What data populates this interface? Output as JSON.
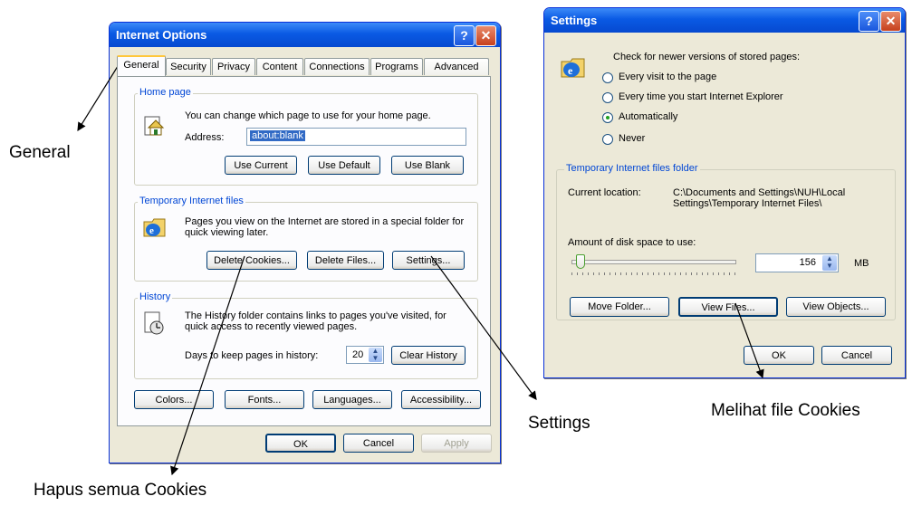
{
  "callouts": {
    "general": "General",
    "delete_cookies": "Hapus semua Cookies",
    "settings": "Settings",
    "view_files": "Melihat file Cookies"
  },
  "internet_options": {
    "title": "Internet Options",
    "help_glyph": "?",
    "close_glyph": "✕",
    "tabs": [
      "General",
      "Security",
      "Privacy",
      "Content",
      "Connections",
      "Programs",
      "Advanced"
    ],
    "home_page": {
      "label": "Home page",
      "description": "You can change which page to use for your home page.",
      "address_label": "Address:",
      "address_value": "about:blank",
      "buttons": [
        "Use Current",
        "Use Default",
        "Use Blank"
      ]
    },
    "temp_files": {
      "label": "Temporary Internet files",
      "description": "Pages you view on the Internet are stored in a special folder for quick viewing later.",
      "buttons": [
        "Delete Cookies...",
        "Delete Files...",
        "Settings..."
      ]
    },
    "history": {
      "label": "History",
      "description": "The History folder contains links to pages you've visited, for quick access to recently viewed pages.",
      "days_label": "Days to keep pages in history:",
      "days_value": "20",
      "clear_button": "Clear History"
    },
    "bottom_buttons": [
      "Colors...",
      "Fonts...",
      "Languages...",
      "Accessibility..."
    ],
    "dialog_buttons": {
      "ok": "OK",
      "cancel": "Cancel",
      "apply": "Apply"
    }
  },
  "settings": {
    "title": "Settings",
    "help_glyph": "?",
    "close_glyph": "✕",
    "check_label": "Check for newer versions of stored pages:",
    "options": [
      "Every visit to the page",
      "Every time you start Internet Explorer",
      "Automatically",
      "Never"
    ],
    "selected_option": "Automatically",
    "folder_group": "Temporary Internet files folder",
    "current_location_label": "Current location:",
    "current_location_value": "C:\\Documents and Settings\\NUH\\Local Settings\\Temporary Internet Files\\",
    "disk_space_label": "Amount of disk space to use:",
    "disk_space_value": "156",
    "disk_space_unit": "MB",
    "slider_level": 0.03,
    "folder_buttons": [
      "Move Folder...",
      "View Files...",
      "View Objects..."
    ],
    "dialog_buttons": {
      "ok": "OK",
      "cancel": "Cancel"
    }
  }
}
